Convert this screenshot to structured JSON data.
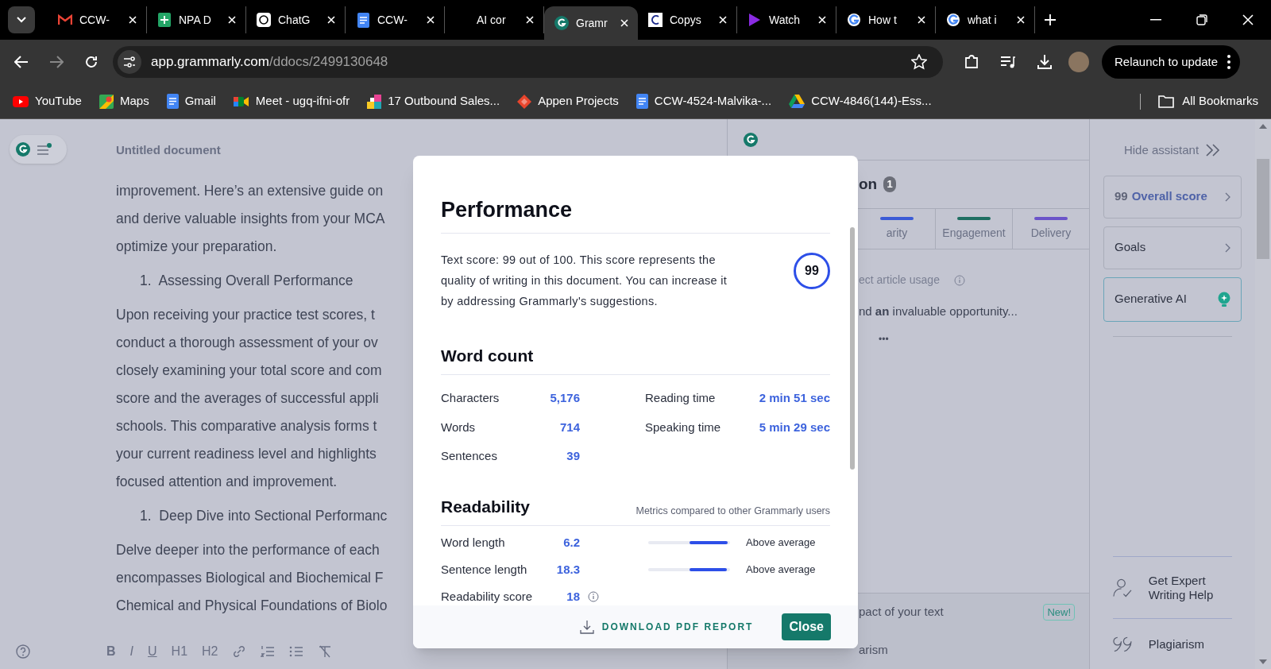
{
  "browser": {
    "tabs": [
      {
        "kind": "gmail",
        "label": "CCW-",
        "selected": false
      },
      {
        "kind": "sheets",
        "label": "NPA D",
        "selected": false
      },
      {
        "kind": "chat",
        "label": "ChatG",
        "selected": false
      },
      {
        "kind": "docs",
        "label": "CCW-",
        "selected": false
      },
      {
        "kind": "blank",
        "label": "AI cor",
        "selected": false
      },
      {
        "kind": "grammarly",
        "label": "Gramr",
        "selected": true
      },
      {
        "kind": "copy",
        "label": "Copys",
        "selected": false
      },
      {
        "kind": "play",
        "label": "Watch",
        "selected": false
      },
      {
        "kind": "google",
        "label": "How t",
        "selected": false
      },
      {
        "kind": "google",
        "label": "what i",
        "selected": false
      }
    ],
    "url_host": "app.grammarly.com",
    "url_path": "/ddocs/2499130648",
    "relaunch": "Relaunch to update",
    "bookmarks": [
      {
        "kind": "youtube",
        "label": "YouTube"
      },
      {
        "kind": "maps",
        "label": "Maps"
      },
      {
        "kind": "docs",
        "label": "Gmail"
      },
      {
        "kind": "meet",
        "label": "Meet - ugq-ifni-ofr"
      },
      {
        "kind": "tiles",
        "label": "17 Outbound Sales..."
      },
      {
        "kind": "appen",
        "label": "Appen Projects"
      },
      {
        "kind": "docs",
        "label": "CCW-4524-Malvika-..."
      },
      {
        "kind": "drive",
        "label": "CCW-4846(144)-Ess..."
      }
    ],
    "all_bookmarks": "All Bookmarks"
  },
  "document": {
    "title": "Untitled document",
    "blocks": [
      {
        "kind": "para",
        "lines": [
          "improvement. Here’s an extensive guide on",
          "and derive valuable insights from your MCA",
          "optimize your preparation."
        ]
      },
      {
        "kind": "list",
        "number": "1.",
        "text": "Assessing Overall Performance"
      },
      {
        "kind": "para",
        "lines": [
          "Upon receiving your practice test scores, t",
          "conduct a thorough assessment of your ov",
          "closely examining your total score and com",
          "score and the averages of successful appli",
          "schools. This comparative analysis forms t",
          "your current readiness level and highlights",
          "focused attention and improvement."
        ]
      },
      {
        "kind": "list",
        "number": "1.",
        "text": "Deep Dive into Sectional Performanc"
      },
      {
        "kind": "para",
        "lines": [
          "Delve deeper into the performance of each",
          "encompasses Biological and Biochemical F",
          "Chemical and Physical Foundations of Biolo"
        ]
      }
    ],
    "toolbar": [
      "B",
      "I",
      "U",
      "H1",
      "H2"
    ]
  },
  "assistant": {
    "title": "on",
    "count": "1",
    "tabs": [
      {
        "label": "arity",
        "color": "#3b5bd6"
      },
      {
        "label": "Engagement",
        "color": "#1f6f62"
      },
      {
        "label": "Delivery",
        "color": "#6b54c9"
      }
    ],
    "alert_title": "ect article usage",
    "alert_text": "nd **an** invaluable opportunity...",
    "more": "•••",
    "footer": [
      {
        "text": "pact of your text",
        "badge": "New!"
      },
      {
        "text": "arism"
      }
    ]
  },
  "sidebar": {
    "hide": "Hide assistant",
    "cards": [
      {
        "kind": "score",
        "score": "99",
        "label": "Overall score",
        "selected": false
      },
      {
        "kind": "chevron",
        "label": "Goals",
        "selected": false
      },
      {
        "kind": "ai",
        "label": "Generative AI",
        "selected": true
      }
    ],
    "links": [
      {
        "kind": "expert",
        "label": "Get Expert Writing Help"
      },
      {
        "kind": "quote",
        "label": "Plagiarism"
      }
    ]
  },
  "modal": {
    "title": "Performance",
    "score_text": "Text score: 99 out of 100. This score represents the quality of writing in this document. You can increase it by addressing Grammarly's suggestions.",
    "score": "99",
    "word_count_title": "Word count",
    "counts_left": [
      {
        "label": "Characters",
        "value": "5,176"
      },
      {
        "label": "Words",
        "value": "714"
      },
      {
        "label": "Sentences",
        "value": "39"
      }
    ],
    "counts_right": [
      {
        "label": "Reading time",
        "value": "2 min 51 sec"
      },
      {
        "label": "Speaking time",
        "value": "5 min 29 sec"
      }
    ],
    "readability_title": "Readability",
    "readability_note": "Metrics compared to other Grammarly users",
    "metrics": [
      {
        "kind": "bar",
        "label": "Word length",
        "value": "6.2",
        "level": 0.97,
        "rating": "Above average"
      },
      {
        "kind": "bar",
        "label": "Sentence length",
        "value": "18.3",
        "level": 0.96,
        "rating": "Above average"
      },
      {
        "kind": "info",
        "label": "Readability score",
        "value": "18"
      }
    ],
    "download": "DOWNLOAD PDF REPORT",
    "close": "Close"
  }
}
